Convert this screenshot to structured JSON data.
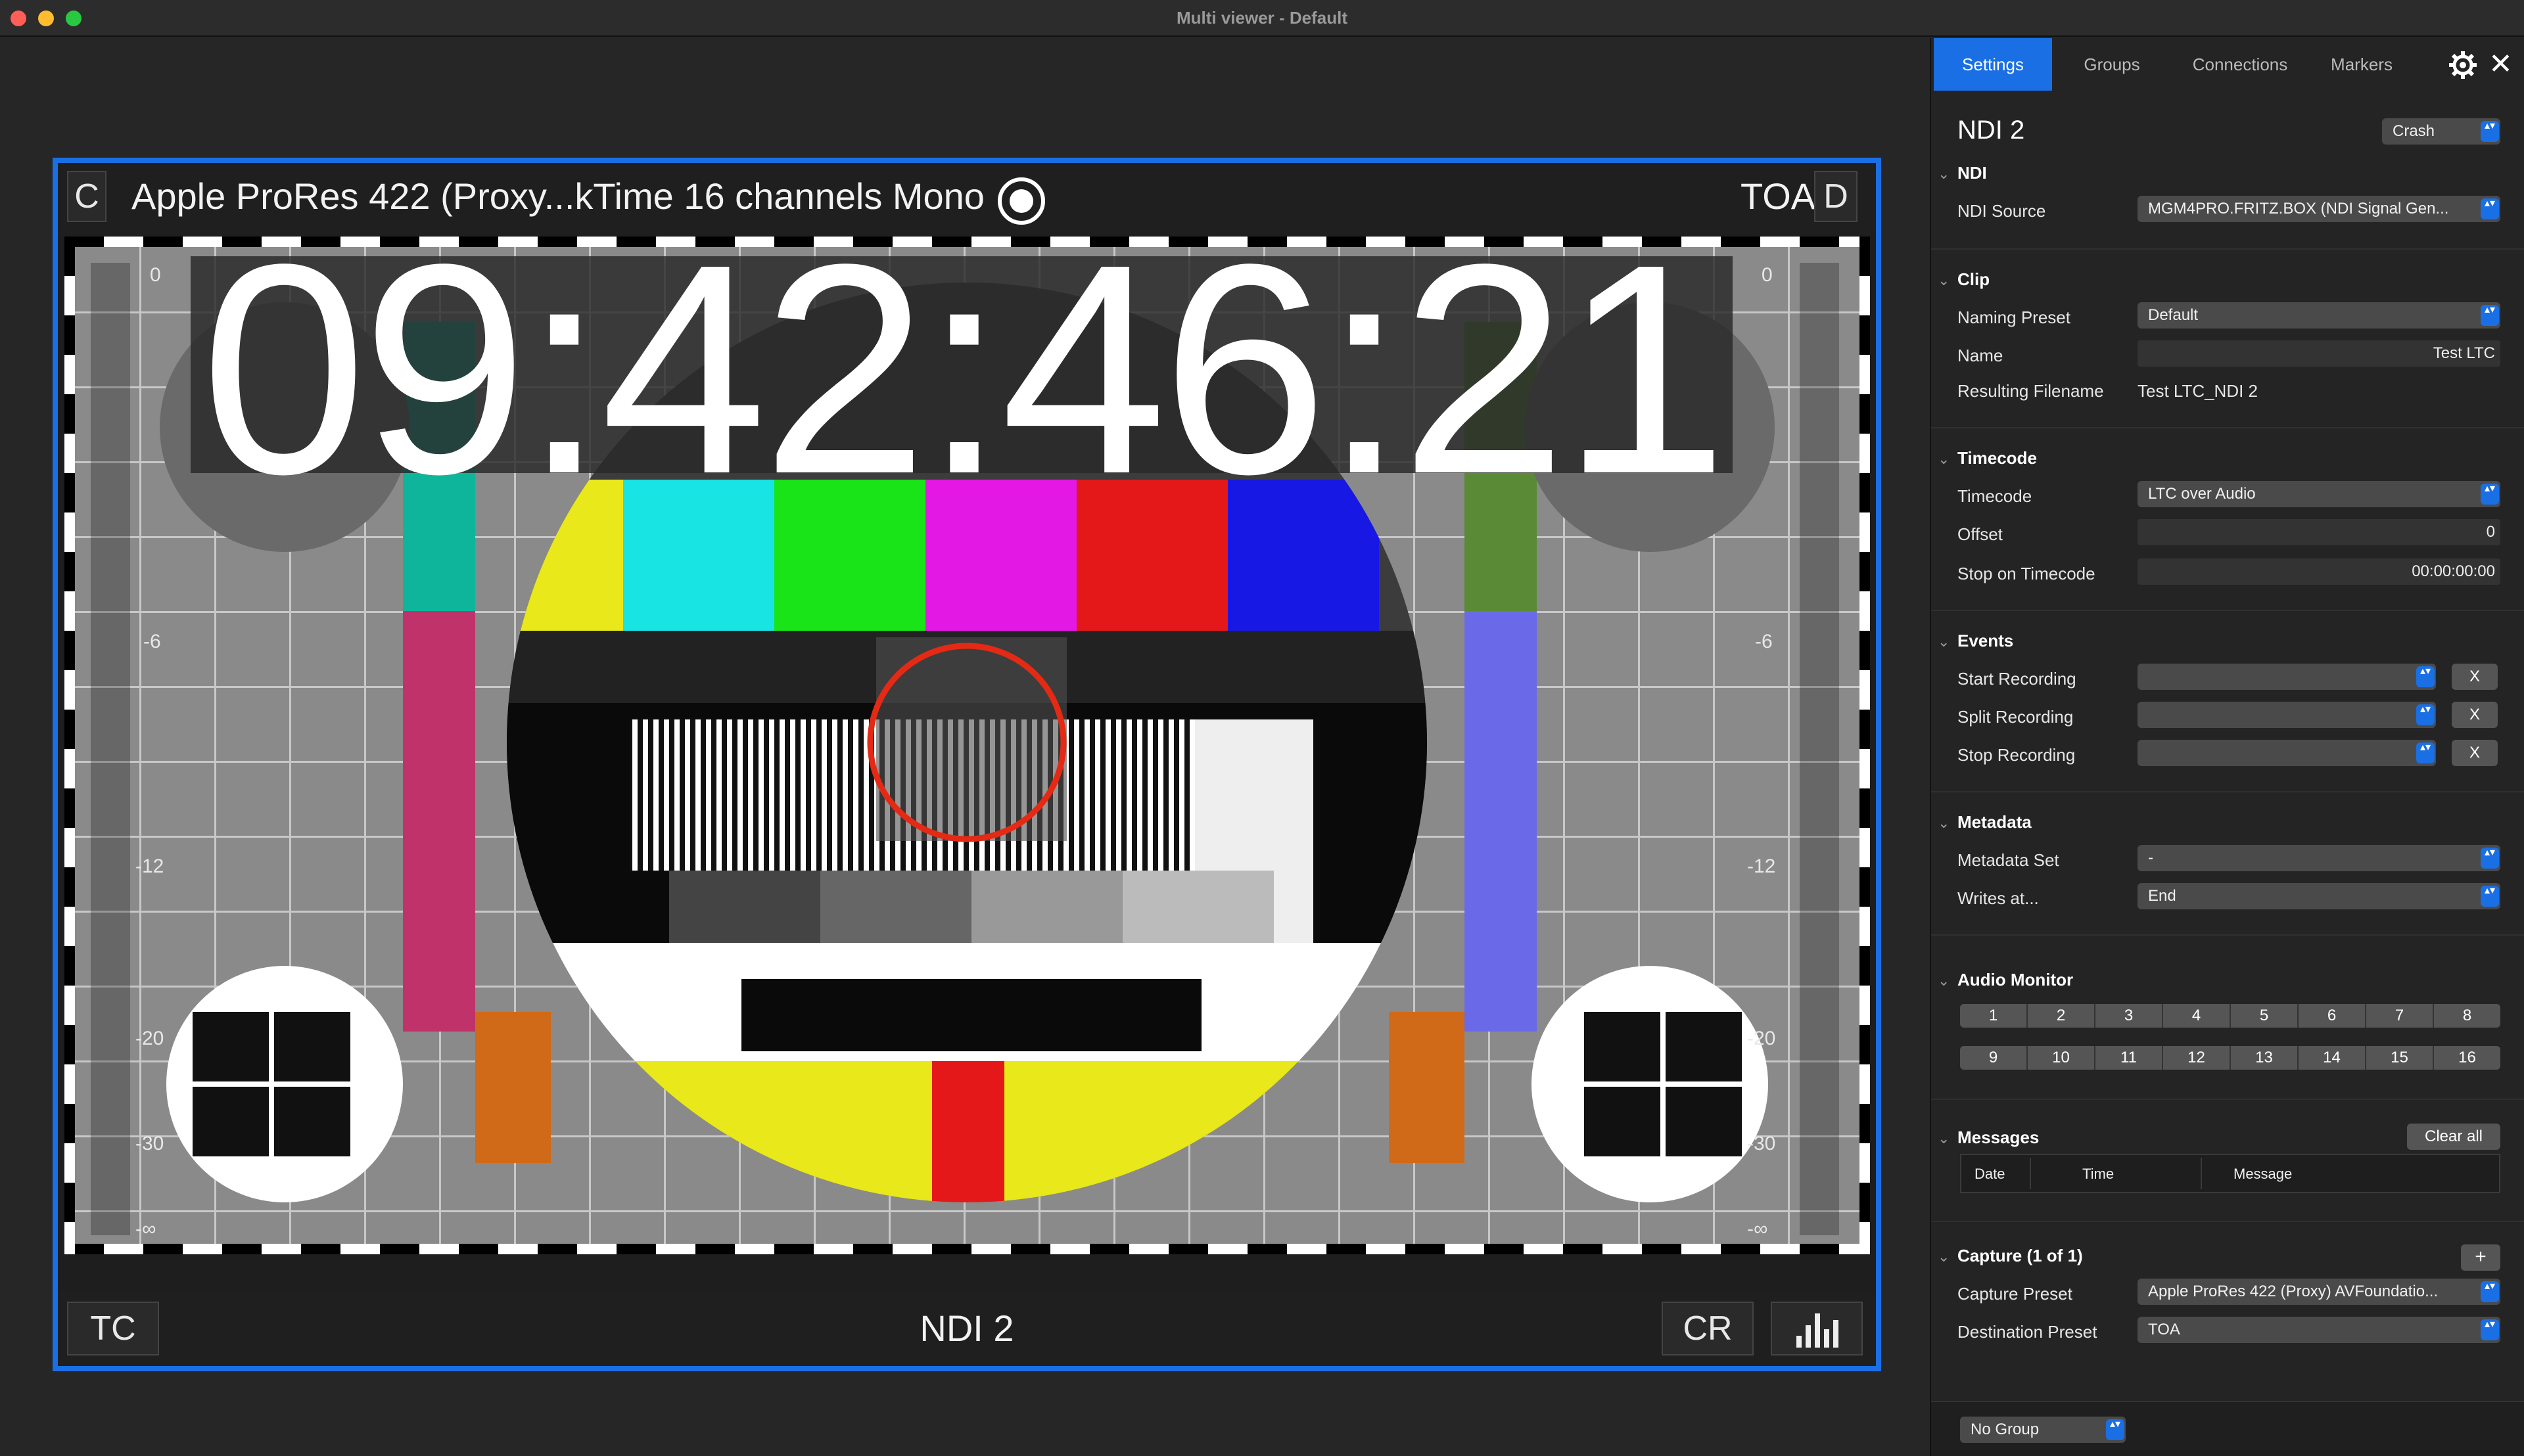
{
  "window": {
    "title": "Multi viewer - Default"
  },
  "tile": {
    "left_badge": "C",
    "title": "Apple ProRes 422 (Proxy...kTime 16 channels Mono",
    "right_label": "TOA",
    "right_badge": "D",
    "timecode": "09:42:46:21",
    "bottom_left": "TC",
    "bottom_center": "NDI 2",
    "bottom_right": "CR",
    "meter_ticks": [
      "0",
      "-6",
      "-12",
      "-20",
      "-30",
      "-∞"
    ]
  },
  "panel": {
    "tabs": [
      "Settings",
      "Groups",
      "Connections",
      "Markers"
    ],
    "source_name": "NDI 2",
    "status": "Crash",
    "ndi": {
      "section": "NDI",
      "source_label": "NDI Source",
      "source_value": "MGM4PRO.FRITZ.BOX (NDI Signal Gen..."
    },
    "clip": {
      "section": "Clip",
      "naming_label": "Naming Preset",
      "naming_value": "Default",
      "name_label": "Name",
      "name_value": "Test LTC",
      "result_label": "Resulting Filename",
      "result_value": "Test LTC_NDI 2"
    },
    "timecode": {
      "section": "Timecode",
      "tc_label": "Timecode",
      "tc_value": "LTC over Audio",
      "offset_label": "Offset",
      "offset_value": "0",
      "stop_label": "Stop on Timecode",
      "stop_value": "00:00:00:00"
    },
    "events": {
      "section": "Events",
      "start": "Start Recording",
      "split": "Split Recording",
      "stop": "Stop Recording",
      "x": "X"
    },
    "metadata": {
      "section": "Metadata",
      "set_label": "Metadata Set",
      "set_value": "-",
      "writes_label": "Writes at...",
      "writes_value": "End"
    },
    "audio": {
      "section": "Audio Monitor",
      "row1": [
        "1",
        "2",
        "3",
        "4",
        "5",
        "6",
        "7",
        "8"
      ],
      "row2": [
        "9",
        "10",
        "11",
        "12",
        "13",
        "14",
        "15",
        "16"
      ]
    },
    "messages": {
      "section": "Messages",
      "clear": "Clear all",
      "cols": [
        "Date",
        "Time",
        "Message"
      ]
    },
    "capture": {
      "section": "Capture (1 of 1)",
      "add": "+",
      "preset_label": "Capture Preset",
      "preset_value": "Apple ProRes 422 (Proxy) AVFoundatio...",
      "dest_label": "Destination Preset",
      "dest_value": "TOA"
    },
    "group": "No Group"
  },
  "colors": {
    "accent": "#1a6fe4",
    "close": "#ff5f57",
    "minimize": "#febc2e",
    "zoom": "#28c840"
  }
}
